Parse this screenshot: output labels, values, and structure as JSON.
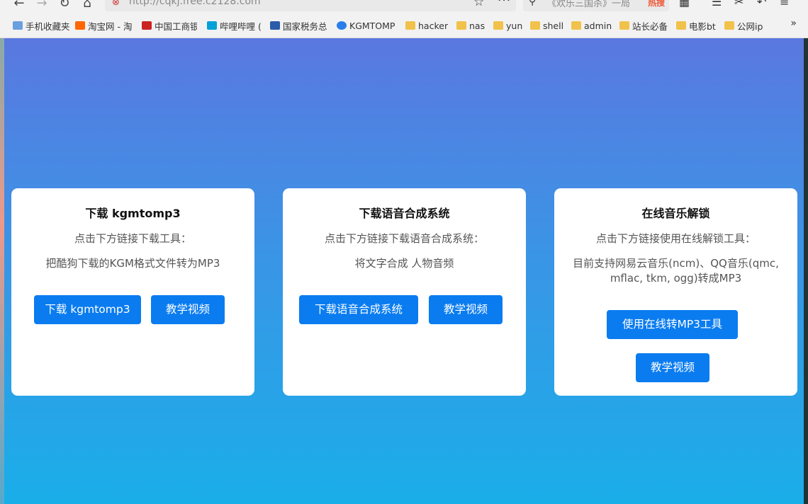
{
  "browser": {
    "url": "http://cqkj.free.c2128.com",
    "search_text": "《欢乐三国杀》一局",
    "search_badge": "热搜",
    "bookmarks": [
      "手机收藏夹",
      "淘宝网 - 淘",
      "中国工商银",
      "哔哩哔哩 (",
      "国家税务总",
      "KGMTOMP",
      "hacker",
      "nas",
      "yun",
      "shell",
      "admin",
      "站长必备",
      "电影bt",
      "公网ip"
    ]
  },
  "cards": [
    {
      "title": "下载 kgmtomp3",
      "subtitle": "点击下方链接下载工具：",
      "description": "把酷狗下载的KGM格式文件转为MP3",
      "buttons": [
        "下载 kgmtomp3",
        "教学视频"
      ]
    },
    {
      "title": "下载语音合成系统",
      "subtitle": "点击下方链接下载语音合成系统：",
      "description": "将文字合成 人物音频",
      "buttons": [
        "下载语音合成系统",
        "教学视频"
      ]
    },
    {
      "title": "在线音乐解锁",
      "subtitle": "点击下方链接使用在线解锁工具：",
      "description": "目前支持网易云音乐(ncm)、QQ音乐(qmc, mflac, tkm, ogg)转成MP3",
      "buttons": [
        "使用在线转MP3工具",
        "教学视频"
      ]
    }
  ],
  "colors": {
    "button": "#0a7cf0",
    "gradient_top": "#5a78e0",
    "gradient_bottom": "#1aaee9"
  }
}
